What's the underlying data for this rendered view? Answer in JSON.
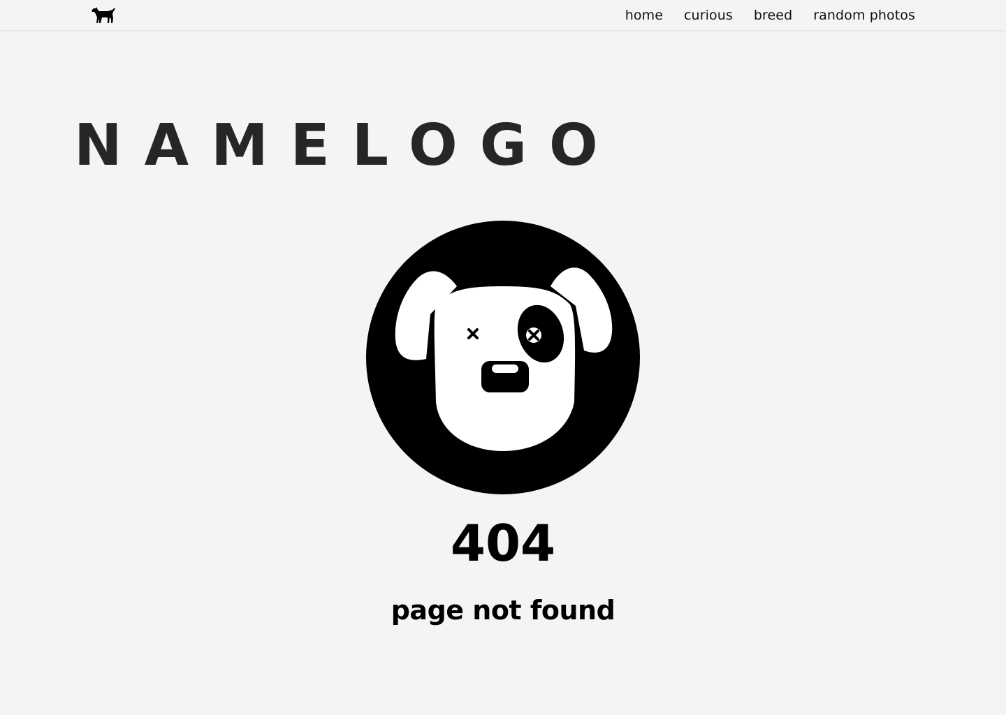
{
  "header": {
    "logo_icon": "dog-silhouette-icon",
    "nav": [
      {
        "label": "home"
      },
      {
        "label": "curious"
      },
      {
        "label": "breed"
      },
      {
        "label": "random photos"
      }
    ]
  },
  "hero": {
    "wordmark": "NAMELOGO",
    "illustration_icon": "dead-dog-face-icon"
  },
  "error": {
    "code": "404",
    "message": "page not found"
  },
  "colors": {
    "background": "#f4f4f4",
    "text": "#000000",
    "wordmark": "#262626"
  }
}
